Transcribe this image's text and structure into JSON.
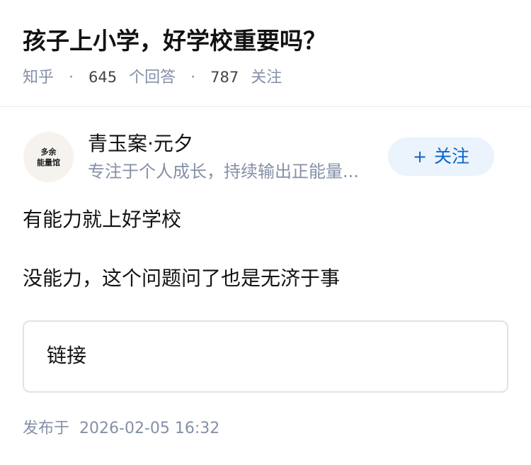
{
  "question": {
    "title": "孩子上小学，好学校重要吗？",
    "source": "知乎",
    "separator": "·",
    "answer_count": "645",
    "answer_label": "个回答",
    "follower_count": "787",
    "follower_label": "关注"
  },
  "author": {
    "avatar_text_line1": "多余",
    "avatar_text_line2": "能量馆",
    "name": "青玉案·元夕",
    "bio": "专注于个人成长，持续输出正能量...",
    "follow_plus": "+",
    "follow_label": "关注"
  },
  "answer": {
    "paragraphs": [
      "有能力就上好学校",
      "没能力，这个问题问了也是无济于事"
    ],
    "link_card_label": "链接"
  },
  "footer": {
    "published_label": "发布于",
    "published_time": "2026-02-05 16:32"
  },
  "colors": {
    "follow_button_bg": "#ebf3fc",
    "follow_button_text": "#0d65c8",
    "meta_text": "#8590a6"
  }
}
